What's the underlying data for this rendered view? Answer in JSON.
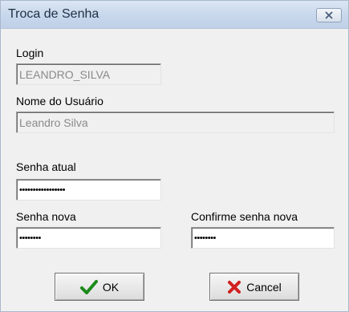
{
  "window": {
    "title": "Troca de Senha"
  },
  "titlebar_icons": {
    "close": "close-icon"
  },
  "form": {
    "login": {
      "label": "Login",
      "value": "LEANDRO_SILVA"
    },
    "user_name": {
      "label": "Nome do Usuário",
      "value": "Leandro Silva"
    },
    "current_password": {
      "label": "Senha atual",
      "value": "•••••••••••••••••"
    },
    "new_password": {
      "label": "Senha nova",
      "value": "••••••••"
    },
    "confirm_password": {
      "label": "Confirme senha nova",
      "value": "••••••••"
    }
  },
  "buttons": {
    "ok": {
      "label": "OK",
      "icon": "checkmark-icon",
      "icon_color": "#1a8a1a"
    },
    "cancel": {
      "label": "Cancel",
      "icon": "x-icon",
      "icon_color": "#d21f1f"
    }
  }
}
